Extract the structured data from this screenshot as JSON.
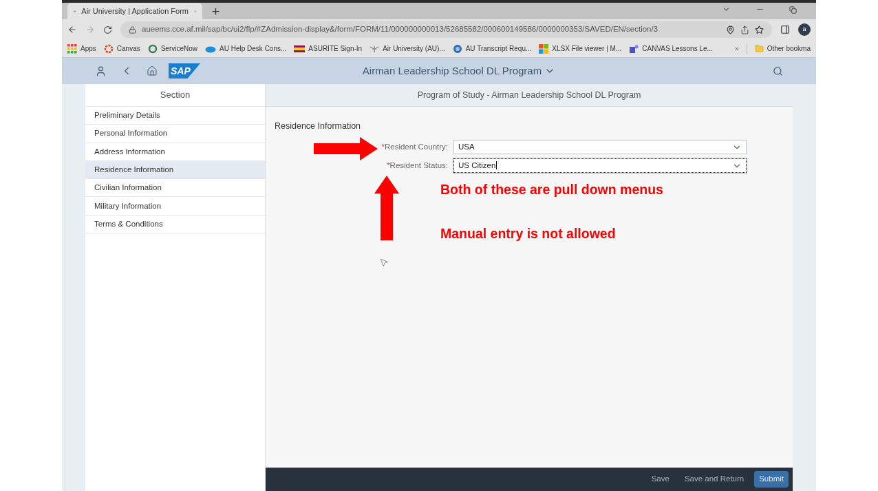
{
  "browser": {
    "tab": {
      "title": "Air University | Application Form"
    },
    "url": "aueems.cce.af.mil/sap/bc/ui2/flp/#ZAdmission-display&/form/FORM/11/000000000013/52685582/000600149586/0000000353/SAVED/EN/section/3",
    "profile_initial": "a",
    "bookmarks": [
      {
        "label": "Apps",
        "kind": "apps"
      },
      {
        "label": "Canvas",
        "kind": "ring"
      },
      {
        "label": "ServiceNow",
        "kind": "circle"
      },
      {
        "label": "AU Help Desk Cons...",
        "kind": "cloud"
      },
      {
        "label": "ASURITE Sign-In",
        "kind": "flag"
      },
      {
        "label": "Air University (AU)...",
        "kind": "wings"
      },
      {
        "label": "AU Transcript Requ...",
        "kind": "globe"
      },
      {
        "label": "XLSX File viewer | M...",
        "kind": "tiles"
      },
      {
        "label": "CANVAS Lessons Le...",
        "kind": "people"
      }
    ],
    "overflow": "»",
    "other_bookmarks": "Other bookma"
  },
  "shell": {
    "logo_text": "SAP",
    "title": "Airman Leadership School DL Program"
  },
  "sidebar": {
    "heading": "Section",
    "items": [
      {
        "label": "Preliminary Details",
        "selected": false
      },
      {
        "label": "Personal Information",
        "selected": false
      },
      {
        "label": "Address Information",
        "selected": false
      },
      {
        "label": "Residence Information",
        "selected": true
      },
      {
        "label": "Civilian Information",
        "selected": false
      },
      {
        "label": "Military Information",
        "selected": false
      },
      {
        "label": "Terms & Conditions",
        "selected": false
      }
    ]
  },
  "page": {
    "title": "Program of Study - Airman Leadership School DL Program",
    "section_title": "Residence Information",
    "fields": [
      {
        "mark": "*",
        "label": "Resident Country:",
        "value": "USA",
        "focused": false
      },
      {
        "mark": "*",
        "label": "Resident Status:",
        "value": "US Citizen",
        "focused": true
      }
    ]
  },
  "annotations": [
    "Both of these are pull down menus",
    "Manual entry is not allowed"
  ],
  "footer": {
    "buttons": [
      {
        "label": "Save",
        "kind": "plain"
      },
      {
        "label": "Save and Return",
        "kind": "plain"
      },
      {
        "label": "Submit",
        "kind": "primary"
      }
    ]
  }
}
